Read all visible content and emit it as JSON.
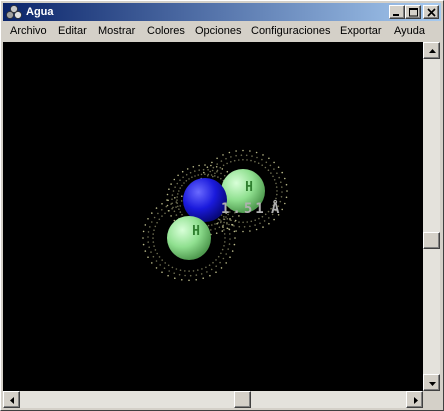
{
  "window": {
    "title": "Agua"
  },
  "titlebar_buttons": [
    {
      "name": "minimize",
      "icon": "minimize-icon"
    },
    {
      "name": "maximize",
      "icon": "maximize-icon"
    },
    {
      "name": "close",
      "icon": "close-icon"
    }
  ],
  "menu": [
    {
      "label": "Archivo"
    },
    {
      "label": "Editar"
    },
    {
      "label": "Mostrar"
    },
    {
      "label": "Colores"
    },
    {
      "label": "Opciones"
    },
    {
      "label": "Configuraciones"
    },
    {
      "label": "Exportar"
    },
    {
      "label": "Ayuda"
    }
  ],
  "viewport": {
    "background": "#000000",
    "atoms": [
      {
        "element": "O",
        "color": "#1a1adc",
        "label": ""
      },
      {
        "element": "H",
        "color": "#90e090",
        "label": "H"
      },
      {
        "element": "H",
        "color": "#90e090",
        "label": "H"
      }
    ],
    "measurement": {
      "value": "1.51",
      "unit": "Å",
      "color": "#b0b0b0"
    },
    "dot_surface_color": "#d8d8a0"
  },
  "scrollbars": {
    "vertical": {
      "position_fraction": 0.58
    },
    "horizontal": {
      "position_fraction": 0.58
    }
  }
}
